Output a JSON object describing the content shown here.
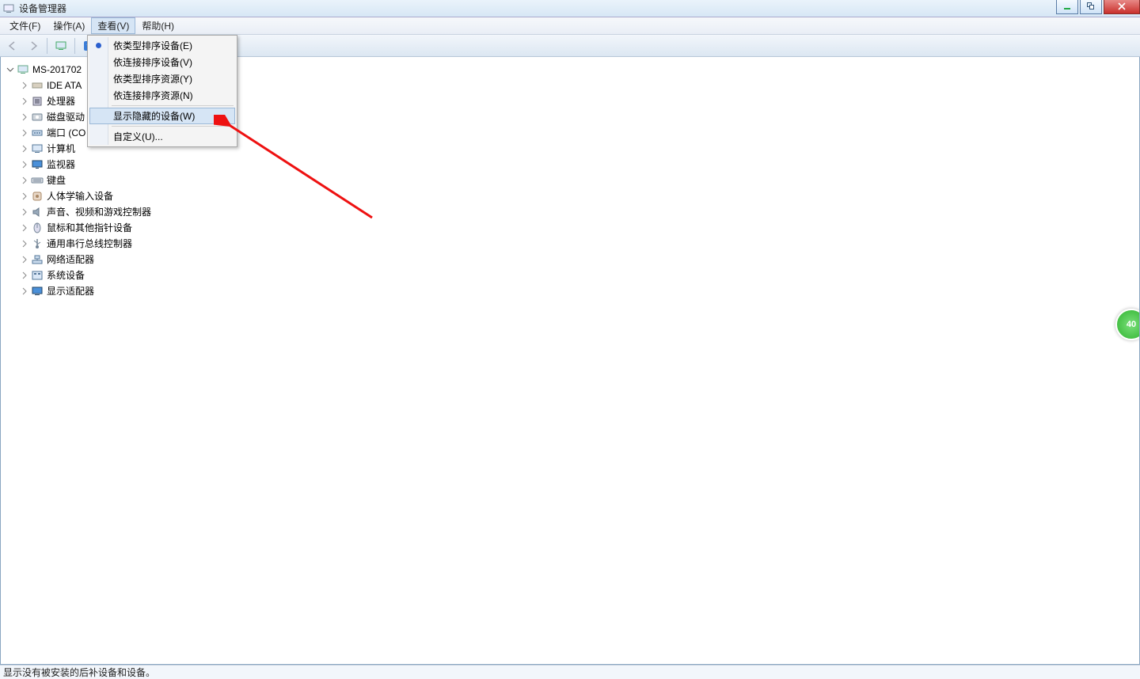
{
  "window": {
    "title": "设备管理器"
  },
  "menubar": {
    "items": [
      {
        "label": "文件(F)"
      },
      {
        "label": "操作(A)"
      },
      {
        "label": "查看(V)"
      },
      {
        "label": "帮助(H)"
      }
    ],
    "active_index": 2
  },
  "dropdown": {
    "items": [
      {
        "label": "依类型排序设备(E)",
        "selected": true
      },
      {
        "label": "依连接排序设备(V)"
      },
      {
        "label": "依类型排序资源(Y)"
      },
      {
        "label": "依连接排序资源(N)"
      }
    ],
    "highlight": {
      "label": "显示隐藏的设备(W)"
    },
    "customize": {
      "label": "自定义(U)..."
    }
  },
  "tree": {
    "root": "MS-201702",
    "nodes": [
      {
        "label": "IDE ATA",
        "icon": "ide"
      },
      {
        "label": "处理器",
        "icon": "cpu"
      },
      {
        "label": "磁盘驱动",
        "icon": "disk"
      },
      {
        "label": "端口 (CO",
        "icon": "port"
      },
      {
        "label": "计算机",
        "icon": "computer"
      },
      {
        "label": "监视器",
        "icon": "monitor"
      },
      {
        "label": "键盘",
        "icon": "keyboard"
      },
      {
        "label": "人体学输入设备",
        "icon": "hid"
      },
      {
        "label": "声音、视频和游戏控制器",
        "icon": "sound"
      },
      {
        "label": "鼠标和其他指针设备",
        "icon": "mouse"
      },
      {
        "label": "通用串行总线控制器",
        "icon": "usb"
      },
      {
        "label": "网络适配器",
        "icon": "network"
      },
      {
        "label": "系统设备",
        "icon": "system"
      },
      {
        "label": "显示适配器",
        "icon": "display"
      }
    ]
  },
  "statusbar": {
    "text": "显示没有被安装的后补设备和设备。"
  },
  "badge": {
    "text": "40"
  },
  "icons": {
    "back": "back-arrow",
    "forward": "forward-arrow",
    "up": "up-arrow",
    "monitor": "monitor",
    "help": "help"
  }
}
